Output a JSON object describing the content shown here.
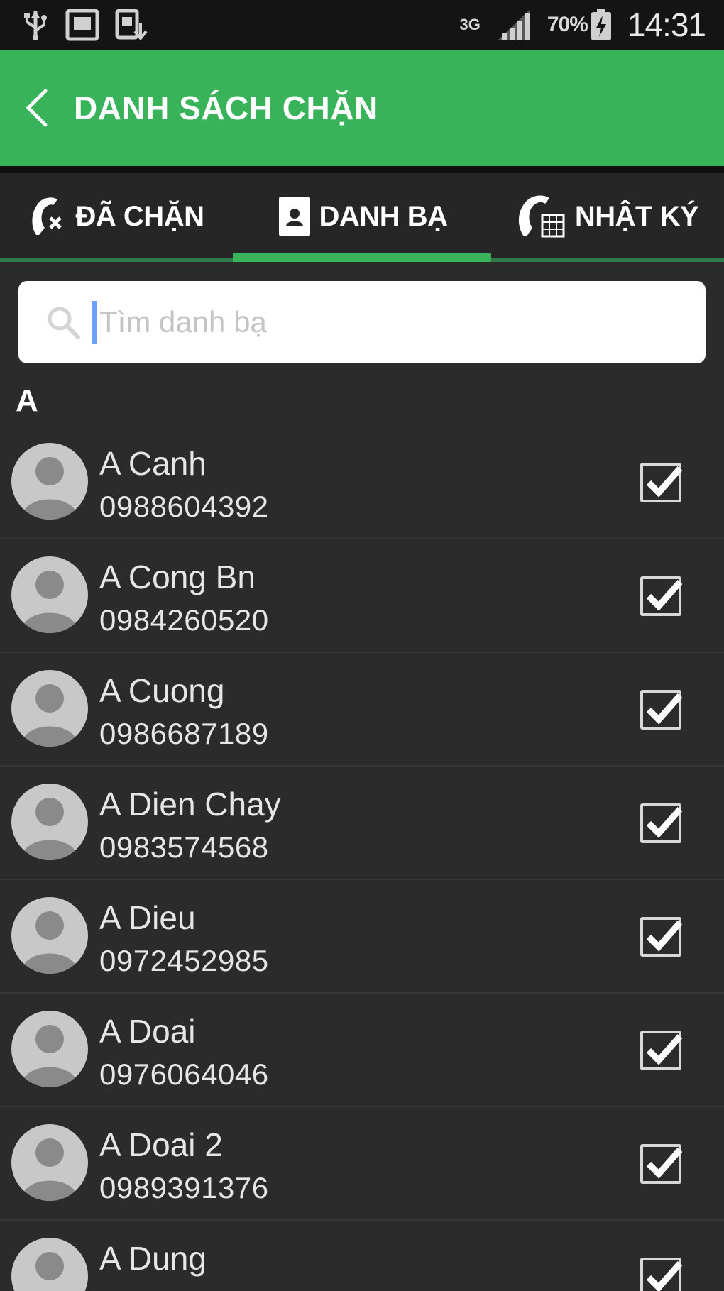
{
  "status_bar": {
    "network": "3G",
    "battery": "70%",
    "time": "14:31"
  },
  "app_bar": {
    "title": "DANH SÁCH CHẶN"
  },
  "tabs": [
    {
      "label": "ĐÃ CHẶN",
      "icon": "blocked-call-icon",
      "active": false
    },
    {
      "label": "DANH BẠ",
      "icon": "contacts-book-icon",
      "active": true
    },
    {
      "label": "NHẬT KÝ",
      "icon": "call-log-icon",
      "active": false
    }
  ],
  "search": {
    "placeholder": "Tìm danh bạ",
    "value": ""
  },
  "section": {
    "letter": "A"
  },
  "contacts": [
    {
      "name": "A Canh",
      "phone": "0988604392",
      "checked": true
    },
    {
      "name": "A Cong Bn",
      "phone": "0984260520",
      "checked": true
    },
    {
      "name": "A Cuong",
      "phone": "0986687189",
      "checked": true
    },
    {
      "name": "A Dien Chay",
      "phone": "0983574568",
      "checked": true
    },
    {
      "name": "A Dieu",
      "phone": "0972452985",
      "checked": true
    },
    {
      "name": "A Doai",
      "phone": "0976064046",
      "checked": true
    },
    {
      "name": "A Doai 2",
      "phone": "0989391376",
      "checked": true
    },
    {
      "name": "A Dung",
      "phone": "",
      "checked": true
    }
  ],
  "colors": {
    "accent": "#39b35a",
    "background": "#2b2b2b",
    "status_bar": "#141414"
  }
}
